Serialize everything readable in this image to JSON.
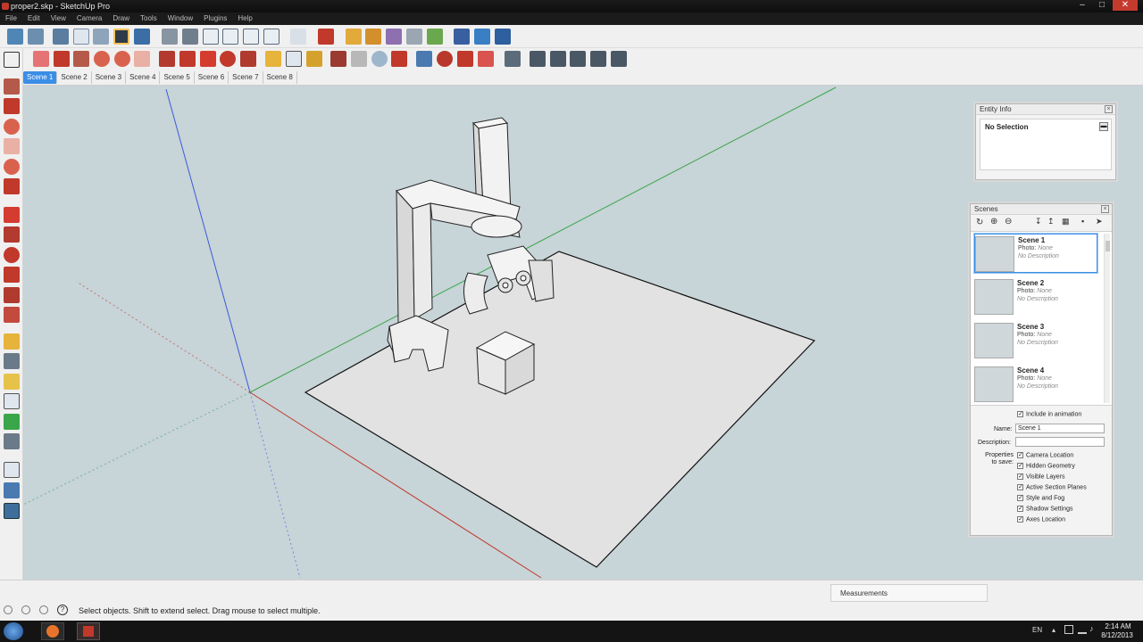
{
  "window": {
    "title": "proper2.skp - SketchUp Pro"
  },
  "menu": [
    "File",
    "Edit",
    "View",
    "Camera",
    "Draw",
    "Tools",
    "Window",
    "Plugins",
    "Help"
  ],
  "scene_tabs": [
    "Scene 1",
    "Scene 2",
    "Scene 3",
    "Scene 4",
    "Scene 5",
    "Scene 6",
    "Scene 7",
    "Scene 8"
  ],
  "entity_info": {
    "title": "Entity Info",
    "selection": "No Selection"
  },
  "scenes_panel": {
    "title": "Scenes",
    "list": [
      {
        "name": "Scene 1",
        "photo_label": "Photo:",
        "photo": "None",
        "description": "No Description"
      },
      {
        "name": "Scene 2",
        "photo_label": "Photo:",
        "photo": "None",
        "description": "No Description"
      },
      {
        "name": "Scene 3",
        "photo_label": "Photo:",
        "photo": "None",
        "description": "No Description"
      },
      {
        "name": "Scene 4",
        "photo_label": "Photo:",
        "photo": "None",
        "description": "No Description"
      }
    ],
    "include_in_animation": "Include in animation",
    "name_label": "Name:",
    "name_value": "Scene 1",
    "description_label": "Description:",
    "properties_label": "Properties to save:",
    "properties": [
      "Camera Location",
      "Hidden Geometry",
      "Visible Layers",
      "Active Section Planes",
      "Style and Fog",
      "Shadow Settings",
      "Axes Location"
    ]
  },
  "status": {
    "message": "Select objects. Shift to extend select. Drag mouse to select multiple.",
    "measurements_label": "Measurements"
  },
  "taskbar": {
    "lang": "EN",
    "time": "2:14 AM",
    "date": "8/12/2013"
  },
  "colors": {
    "viewport": "#c7d4d8",
    "selection_blue": "#3a8ee6",
    "axis_red": "#c0392b",
    "axis_green": "#3aa64a",
    "axis_blue": "#3b5bd6"
  }
}
